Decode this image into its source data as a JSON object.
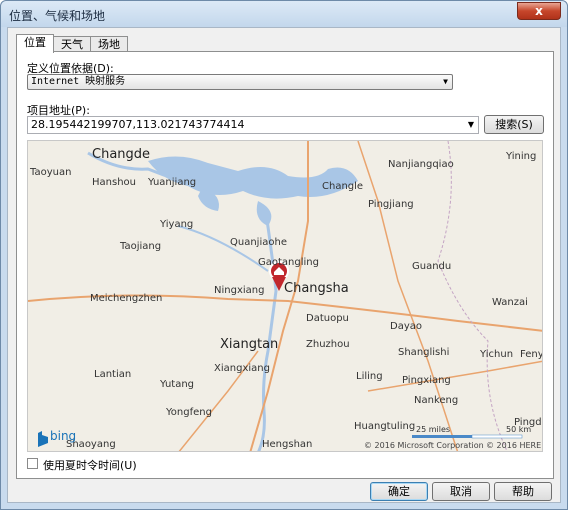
{
  "window": {
    "title": "位置、气候和场地",
    "close_label": "x"
  },
  "tabs": [
    {
      "label": "位置"
    },
    {
      "label": "天气"
    },
    {
      "label": "场地"
    }
  ],
  "location": {
    "define_label": "定义位置依据(D):",
    "define_value": "Internet 映射服务",
    "address_label": "项目地址(P):",
    "address_value": "28.195442199707,113.021743774414",
    "search_label": "搜索(S)"
  },
  "map": {
    "cities_major": [
      "Changde",
      "Changsha",
      "Xiangtan"
    ],
    "cities": [
      "Taoyuan",
      "Hanshou",
      "Yuanjiang",
      "Nanjiangqiao",
      "Yining",
      "Changle",
      "Pingjiang",
      "Yiyang",
      "Quanjiaohe",
      "Taojiang",
      "Gaotangling",
      "Guandu",
      "Ningxiang",
      "Meichengzhen",
      "Datuopu",
      "Wanzai",
      "Dayao",
      "Zhuzhou",
      "Shanglishi",
      "Yichun",
      "Fenyi",
      "Lantian",
      "Xiangxiang",
      "Liling",
      "Pingxiang",
      "Yutang",
      "Nankeng",
      "Yongfeng",
      "Huangtuling",
      "Pingdu",
      "Shaoyang",
      "Hengshan"
    ],
    "scale_miles": "25 miles",
    "scale_km": "50 km",
    "copyright_ms": "© 2016 Microsoft Corporation",
    "copyright_here": "© 2016 HERE",
    "brand": "bing",
    "highway_badges": [
      "107",
      "106",
      "107",
      "320",
      "320",
      "107"
    ]
  },
  "dst": {
    "label": "使用夏时令时间(U)",
    "checked": false
  },
  "buttons": {
    "ok": "确定",
    "cancel": "取消",
    "help": "帮助"
  }
}
